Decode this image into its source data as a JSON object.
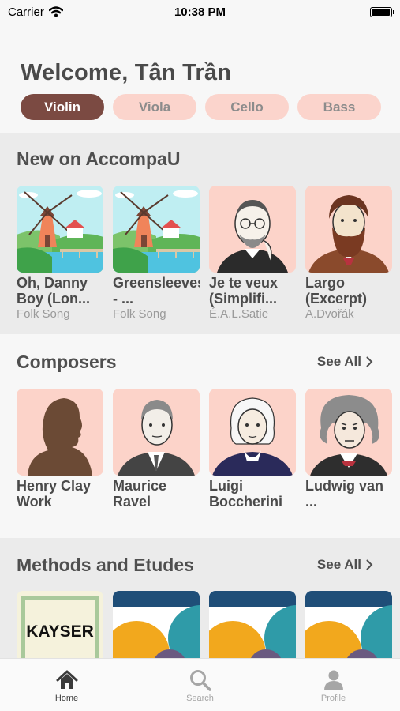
{
  "status_bar": {
    "carrier": "Carrier",
    "time": "10:38 PM",
    "battery_level": 0.95
  },
  "header": {
    "greeting": "Welcome, Tân Trần",
    "instruments": [
      "Violin",
      "Viola",
      "Cello",
      "Bass"
    ],
    "selected_instrument": "Violin"
  },
  "new_section": {
    "title": "New on AccompaU",
    "items": [
      {
        "title": "Oh, Danny Boy (Lon...",
        "subtitle": "Folk Song",
        "thumb": "windmill-illustration"
      },
      {
        "title": "Greensleeves - ...",
        "subtitle": "Folk Song",
        "thumb": "windmill-illustration"
      },
      {
        "title": "Je te veux (Simplifi...",
        "subtitle": "É.A.L.Satie",
        "thumb": "satie-portrait"
      },
      {
        "title": "Largo (Excerpt)",
        "subtitle": "A.Dvořák",
        "thumb": "dvorak-portrait"
      }
    ]
  },
  "composers_section": {
    "title": "Composers",
    "see_all": "See All",
    "items": [
      {
        "name": "Henry Clay Work",
        "thumb": "silhouette-portrait"
      },
      {
        "name": "Maurice Ravel",
        "thumb": "ravel-portrait"
      },
      {
        "name": "Luigi Boccherini",
        "thumb": "boccherini-portrait"
      },
      {
        "name": "Ludwig van ...",
        "thumb": "beethoven-portrait"
      }
    ]
  },
  "methods_section": {
    "title": "Methods and Etudes",
    "see_all": "See All",
    "items": [
      {
        "cover_text": "KAYSER",
        "thumb": "kayser-cover"
      },
      {
        "thumb": "abstract-cover"
      },
      {
        "thumb": "abstract-cover"
      },
      {
        "thumb": "abstract-cover"
      }
    ]
  },
  "tab_bar": {
    "tabs": [
      {
        "label": "Home",
        "icon": "home-icon"
      },
      {
        "label": "Search",
        "icon": "search-icon"
      },
      {
        "label": "Profile",
        "icon": "profile-icon"
      }
    ],
    "active": "Home"
  },
  "colors": {
    "accent": "#7b4a42",
    "chip_background": "#fbd4cc",
    "portrait_background": "#fcd3c9",
    "section_gray": "#ebebeb"
  }
}
